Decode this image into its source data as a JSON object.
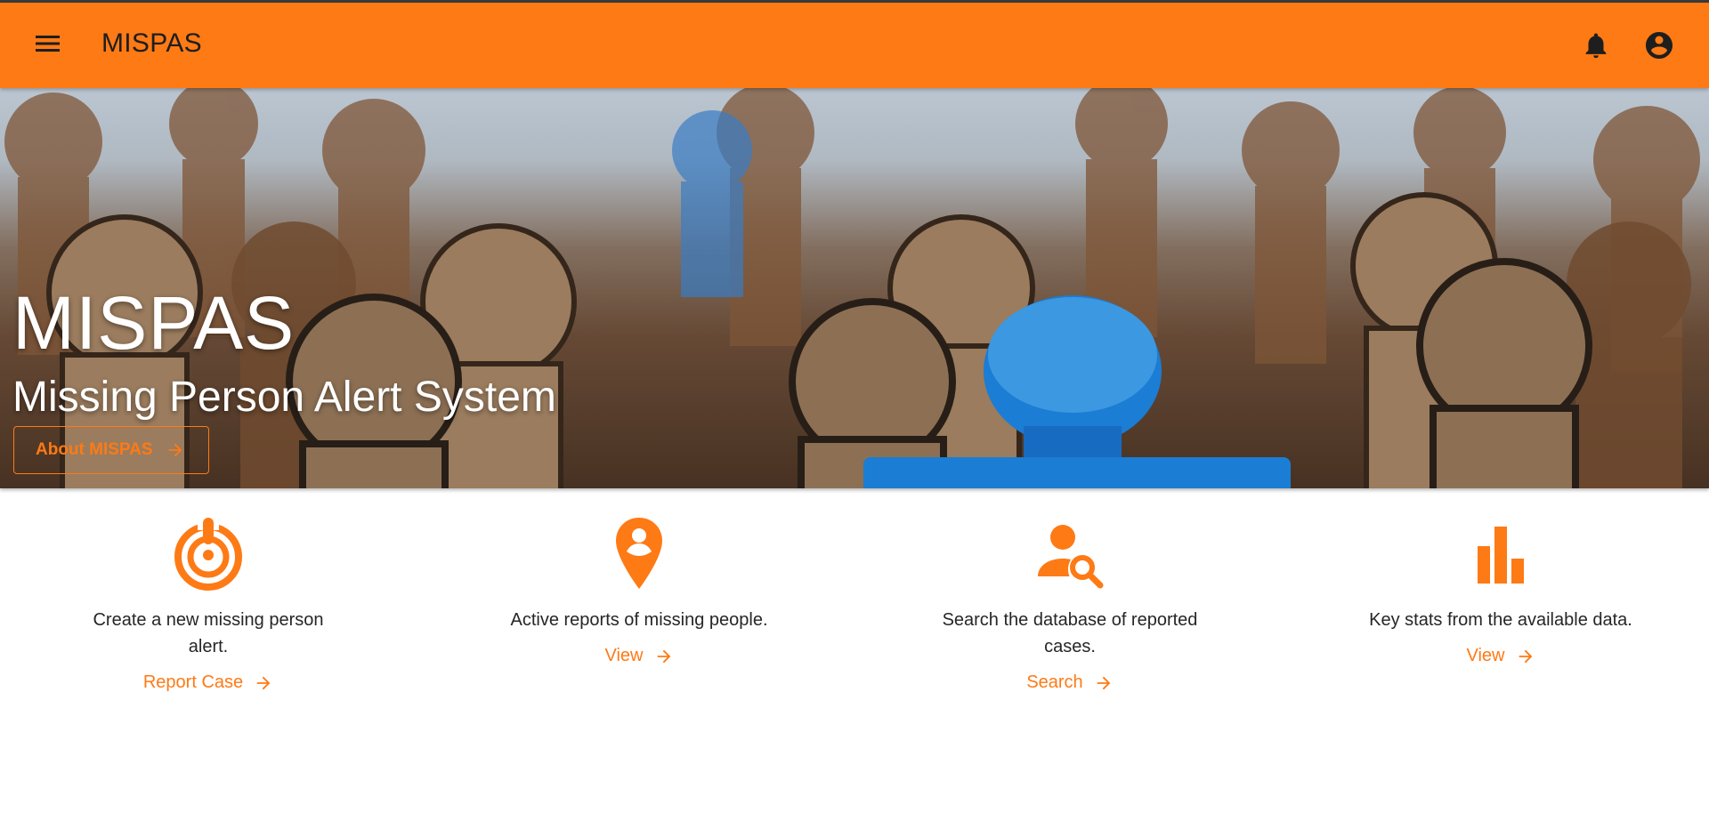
{
  "appbar": {
    "title": "MISPAS",
    "color": "#fe7a15",
    "icons": {
      "menu": "menu-icon",
      "notifications": "bell-icon",
      "account": "account-circle-icon"
    }
  },
  "hero": {
    "title": "MISPAS",
    "subtitle": "Missing Person Alert System",
    "about_button": "About MISPAS"
  },
  "features": [
    {
      "icon": "alert-target-icon",
      "description": "Create a new missing person alert.",
      "action": "Report Case"
    },
    {
      "icon": "location-person-pin-icon",
      "description": "Active reports of missing people.",
      "action": "View"
    },
    {
      "icon": "person-search-icon",
      "description": "Search the database of reported cases.",
      "action": "Search"
    },
    {
      "icon": "bar-chart-icon",
      "description": "Key stats from the available data.",
      "action": "View"
    }
  ],
  "colors": {
    "accent": "#fe7a15",
    "text": "#262626"
  }
}
